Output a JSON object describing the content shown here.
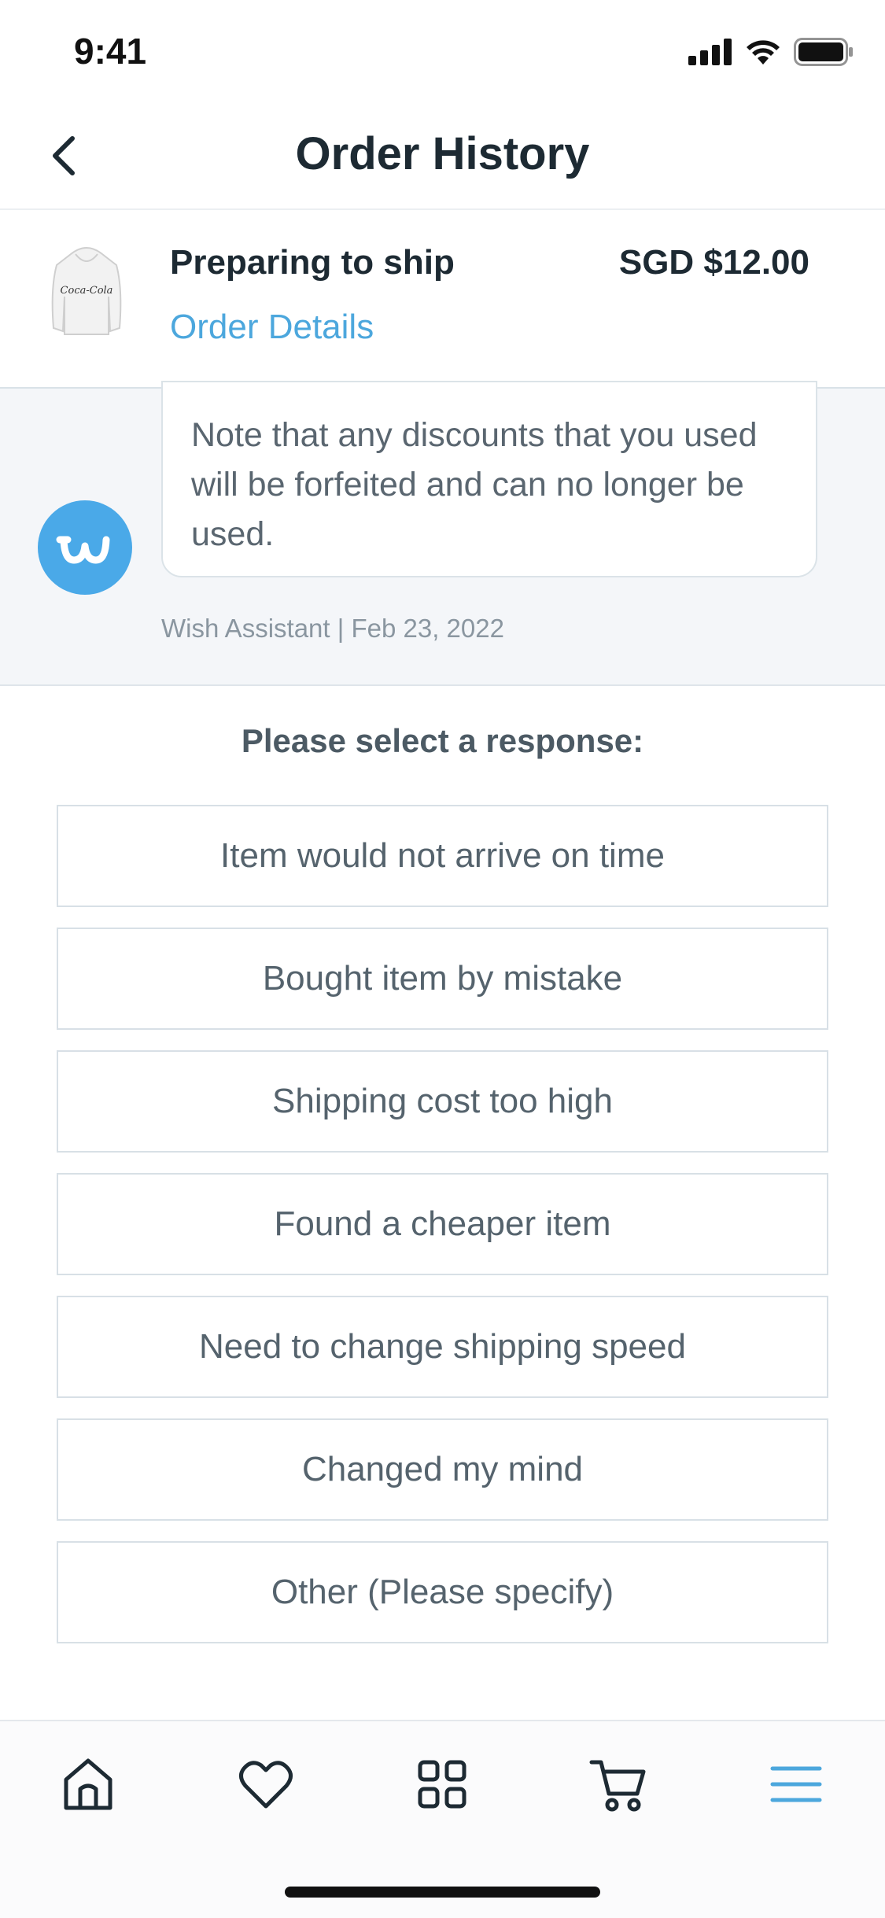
{
  "status_bar": {
    "time": "9:41"
  },
  "header": {
    "title": "Order History"
  },
  "order": {
    "status": "Preparing to ship",
    "price": "SGD $12.00",
    "details_link": "Order Details",
    "product_logo": "Coca-Cola"
  },
  "chat": {
    "message": "Note that any discounts that you used will be forfeited and can no longer be used.",
    "meta": "Wish Assistant | Feb 23, 2022",
    "avatar_icon": "wish-logo-icon"
  },
  "responses": {
    "prompt": "Please select a response:",
    "options": [
      "Item would not arrive on time",
      "Bought item by mistake",
      "Shipping cost too high",
      "Found a cheaper item",
      "Need to change shipping speed",
      "Changed my mind",
      "Other (Please specify)"
    ]
  },
  "tabbar": {
    "items": [
      "home-icon",
      "heart-icon",
      "grid-icon",
      "cart-icon",
      "menu-icon"
    ],
    "active": "menu-icon",
    "active_color": "#4ca7dd"
  },
  "colors": {
    "accent": "#4ca7dd",
    "wish_blue": "#4aa9e8"
  }
}
